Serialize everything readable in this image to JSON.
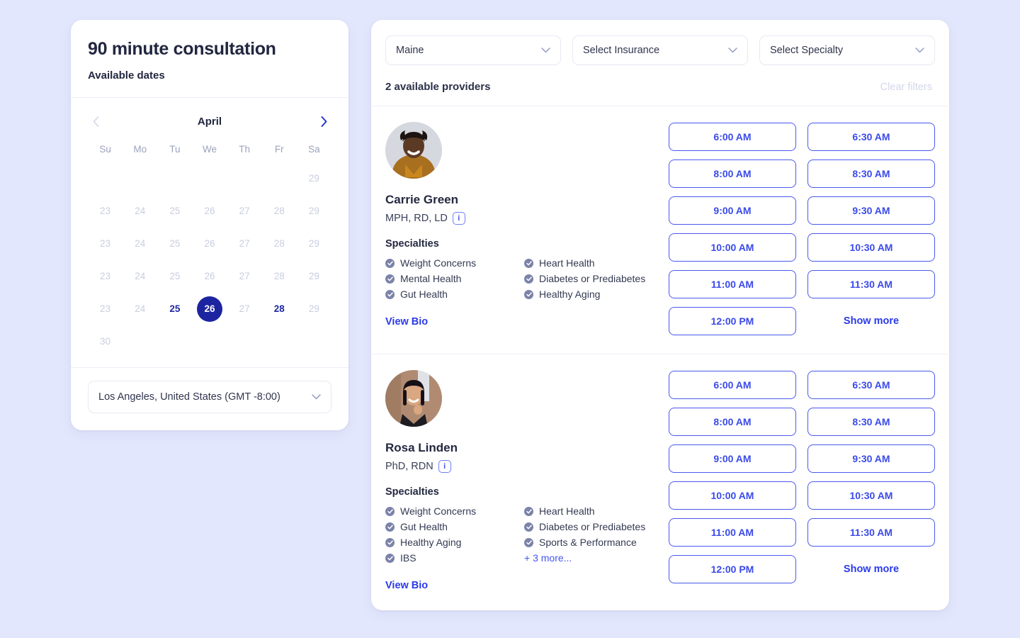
{
  "booking": {
    "title": "90 minute consultation",
    "subtitle": "Available dates",
    "timezone": "Los Angeles, United States (GMT -8:00)"
  },
  "calendar": {
    "month": "April",
    "prev_icon": "chevron-left-icon",
    "next_icon": "chevron-right-icon",
    "weekdays": [
      "Su",
      "Mo",
      "Tu",
      "We",
      "Th",
      "Fr",
      "Sa"
    ],
    "selected_day": "26",
    "weeks": [
      [
        {
          "label": "",
          "state": "empty"
        },
        {
          "label": "",
          "state": "empty"
        },
        {
          "label": "",
          "state": "empty"
        },
        {
          "label": "",
          "state": "empty"
        },
        {
          "label": "",
          "state": "empty"
        },
        {
          "label": "",
          "state": "empty"
        },
        {
          "label": "29",
          "state": "disabled"
        }
      ],
      [
        {
          "label": "23",
          "state": "disabled"
        },
        {
          "label": "24",
          "state": "disabled"
        },
        {
          "label": "25",
          "state": "disabled"
        },
        {
          "label": "26",
          "state": "disabled"
        },
        {
          "label": "27",
          "state": "disabled"
        },
        {
          "label": "28",
          "state": "disabled"
        },
        {
          "label": "29",
          "state": "disabled"
        }
      ],
      [
        {
          "label": "23",
          "state": "disabled"
        },
        {
          "label": "24",
          "state": "disabled"
        },
        {
          "label": "25",
          "state": "disabled"
        },
        {
          "label": "26",
          "state": "disabled"
        },
        {
          "label": "27",
          "state": "disabled"
        },
        {
          "label": "28",
          "state": "disabled"
        },
        {
          "label": "29",
          "state": "disabled"
        }
      ],
      [
        {
          "label": "23",
          "state": "disabled"
        },
        {
          "label": "24",
          "state": "disabled"
        },
        {
          "label": "25",
          "state": "disabled"
        },
        {
          "label": "26",
          "state": "disabled"
        },
        {
          "label": "27",
          "state": "disabled"
        },
        {
          "label": "28",
          "state": "disabled"
        },
        {
          "label": "29",
          "state": "disabled"
        }
      ],
      [
        {
          "label": "23",
          "state": "disabled"
        },
        {
          "label": "24",
          "state": "disabled"
        },
        {
          "label": "25",
          "state": "available"
        },
        {
          "label": "26",
          "state": "selected"
        },
        {
          "label": "27",
          "state": "disabled"
        },
        {
          "label": "28",
          "state": "available"
        },
        {
          "label": "29",
          "state": "disabled"
        }
      ],
      [
        {
          "label": "30",
          "state": "disabled"
        },
        {
          "label": "",
          "state": "empty"
        },
        {
          "label": "",
          "state": "empty"
        },
        {
          "label": "",
          "state": "empty"
        },
        {
          "label": "",
          "state": "empty"
        },
        {
          "label": "",
          "state": "empty"
        },
        {
          "label": "",
          "state": "empty"
        }
      ]
    ]
  },
  "filters": {
    "state": {
      "value": "Maine",
      "icon": "chevron-down-icon"
    },
    "insurance": {
      "value": "Select Insurance",
      "icon": "chevron-down-icon"
    },
    "specialty": {
      "value": "Select Specialty",
      "icon": "chevron-down-icon"
    },
    "results_count": "2 available providers",
    "clear_label": "Clear filters"
  },
  "labels": {
    "specialties_heading": "Specialties",
    "view_bio": "View Bio",
    "show_more": "Show more",
    "info_glyph": "i"
  },
  "providers": [
    {
      "name": "Carrie Green",
      "credentials": "MPH, RD, LD",
      "avatar": "provider-photo-carrie-green",
      "specialties_left": [
        "Weight Concerns",
        "Mental Health",
        "Gut Health"
      ],
      "specialties_right": [
        "Heart Health",
        "Diabetes or Prediabetes",
        "Healthy Aging"
      ],
      "more_specialties": "",
      "slots": [
        "6:00 AM",
        "6:30 AM",
        "8:00 AM",
        "8:30 AM",
        "9:00 AM",
        "9:30 AM",
        "10:00 AM",
        "10:30 AM",
        "11:00 AM",
        "11:30 AM",
        "12:00 PM"
      ]
    },
    {
      "name": "Rosa Linden",
      "credentials": "PhD, RDN",
      "avatar": "provider-photo-rosa-linden",
      "specialties_left": [
        "Weight Concerns",
        "Gut Health",
        "Healthy Aging",
        "IBS"
      ],
      "specialties_right": [
        "Heart Health",
        "Diabetes or Prediabetes",
        "Sports & Performance"
      ],
      "more_specialties": "+ 3 more...",
      "slots": [
        "6:00 AM",
        "6:30 AM",
        "8:00 AM",
        "8:30 AM",
        "9:00 AM",
        "9:30 AM",
        "10:00 AM",
        "10:30 AM",
        "11:00 AM",
        "11:30 AM",
        "12:00 PM"
      ]
    }
  ],
  "colors": {
    "page_background": "#e3e7fd",
    "accent_blue": "#4455ee",
    "selected_navy": "#1c24a0",
    "text_dark": "#232840",
    "check_muted": "#7c83a9",
    "disabled_text": "#c9cde0"
  }
}
